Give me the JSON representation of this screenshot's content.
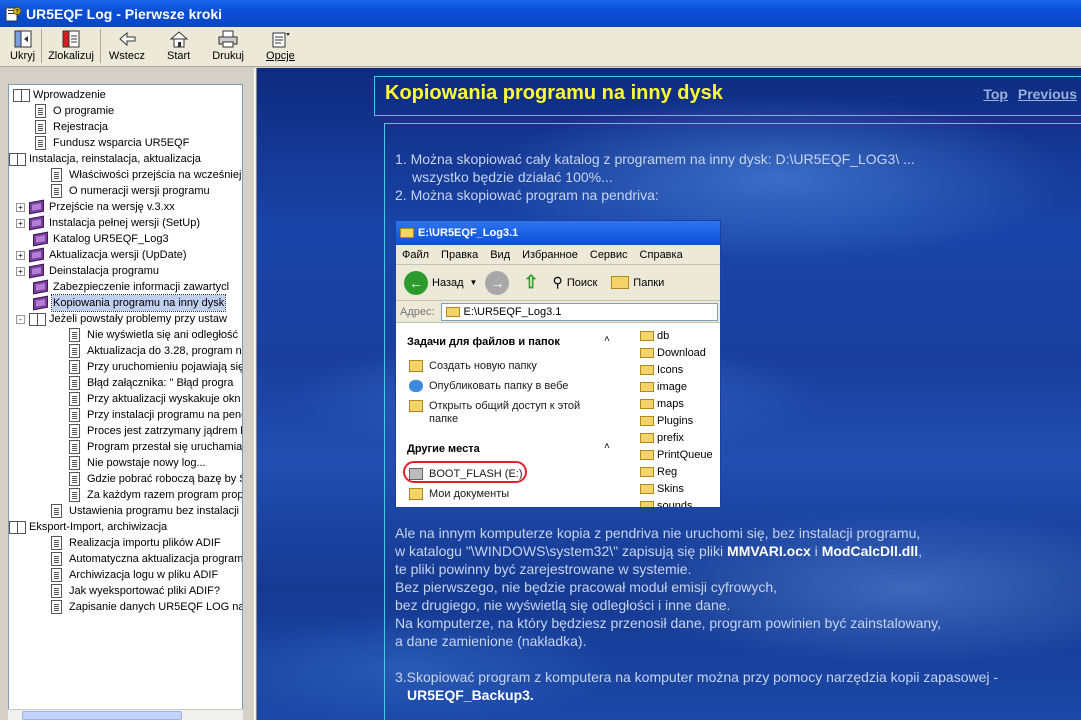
{
  "window": {
    "title": "UR5EQF Log - Pierwsze kroki"
  },
  "toolbar": {
    "buttons": [
      {
        "label": "Ukryj"
      },
      {
        "label": "Zlokalizuj"
      },
      {
        "label": "Wstecz"
      },
      {
        "label": "Start"
      },
      {
        "label": "Drukuj"
      },
      {
        "label": "Opcje"
      }
    ]
  },
  "tree": {
    "items": [
      {
        "label": "Wprowadzenie"
      },
      {
        "label": "O programie"
      },
      {
        "label": "Rejestracja"
      },
      {
        "label": "Fundusz wsparcia UR5EQF"
      },
      {
        "label": "Instalacja, reinstalacja, aktualizacja"
      },
      {
        "label": "Właściwości przejścia na wcześniej"
      },
      {
        "label": "O numeracji wersji programu"
      },
      {
        "label": "Przejście na wersję v.3.xx"
      },
      {
        "label": "Instalacja pełnej wersji (SetUp)"
      },
      {
        "label": "Katalog UR5EQF_Log3"
      },
      {
        "label": "Aktualizacja wersji (UpDate)"
      },
      {
        "label": "Deinstalacja programu"
      },
      {
        "label": "Zabezpieczenie informacji zawartycl"
      },
      {
        "label": "Kopiowania programu na inny dysk"
      },
      {
        "label": "Jeżeli powstały problemy przy ustaw"
      },
      {
        "label": "Nie wyświetla się ani odległość"
      },
      {
        "label": "Aktualizacja do 3.28, program n"
      },
      {
        "label": "Przy uruchomieniu pojawiają się"
      },
      {
        "label": "Błąd załącznika: \" Błąd progra"
      },
      {
        "label": "Przy aktualizacji wyskakuje okn"
      },
      {
        "label": "Przy instalacji programu na penc"
      },
      {
        "label": "Proces jest zatrzymany jądrem b"
      },
      {
        "label": "Program przestał się uruchamia"
      },
      {
        "label": "Nie powstaje nowy log..."
      },
      {
        "label": "Gdzie pobrać roboczą bazę by S"
      },
      {
        "label": "Za każdym razem program propi"
      },
      {
        "label": "Ustawienia programu bez instalacji"
      },
      {
        "label": "Eksport-Import, archiwizacja"
      },
      {
        "label": "Realizacja importu plików ADIF"
      },
      {
        "label": "Automatyczna aktualizacja programi"
      },
      {
        "label": "Archiwizacja logu w pliku ADIF"
      },
      {
        "label": "Jak wyeksportować pliki ADIF?"
      },
      {
        "label": "Zapisanie danych UR5EQF LOG na"
      }
    ]
  },
  "page": {
    "title": "Kopiowania programu na inny dysk",
    "links": {
      "top": "Top",
      "previous": "Previous"
    },
    "list1": "1. Można skopiować cały katalog z programem na inny dysk: D:\\UR5EQF_LOG3\\ ...",
    "list1b": "wszystko będzie działać 100%...",
    "list2": "2. Można skopiować program na pendriva:",
    "para": {
      "l1": "Ale na innym komputerze kopia z pendriva nie uruchomi się, bez instalacji programu,",
      "l2a": "w katalogu \"\\WINDOWS\\system32\\\" zapisują się pliki ",
      "l2b": "MMVARI.ocx",
      "l2c": " i ",
      "l2d": "ModCalcDll.dll",
      "l2e": ",",
      "l3": "te pliki powinny być zarejestrowane w systemie.",
      "l4": "Bez pierwszego, nie będzie pracował moduł emisji cyfrowych,",
      "l5": "bez drugiego, nie wyświetlą się odległości i inne dane.",
      "l6": "Na komputerze, na który będziesz przenosił dane, program powinien być zainstalowany,",
      "l7": "a dane zamienione (nakładka)."
    },
    "list3": "3.Skopiować program z komputera na komputer można przy pomocy narzędzia kopii zapasowej -",
    "list3b": "UR5EQF_Backup3."
  },
  "explorer": {
    "title": "E:\\UR5EQF_Log3.1",
    "menu": [
      "Файл",
      "Правка",
      "Вид",
      "Избранное",
      "Сервис",
      "Справка"
    ],
    "back": "Назад",
    "search": "Поиск",
    "folders_btn": "Папки",
    "address_label": "Адрес:",
    "address": "E:\\UR5EQF_Log3.1",
    "tasks_header": "Задачи для файлов и папок",
    "tasks": [
      "Создать новую папку",
      "Опубликовать папку в вебе",
      "Открыть общий доступ к этой",
      "папке"
    ],
    "places_header": "Другие места",
    "places": [
      "BOOT_FLASH (E:)",
      "Мои документы"
    ],
    "folders": [
      "db",
      "Download",
      "Icons",
      "image",
      "maps",
      "Plugins",
      "prefix",
      "PrintQueue",
      "Reg",
      "Skins",
      "sounds"
    ]
  },
  "colors": {
    "title_yellow": "#ffff33",
    "frame_cyan": "#3fd0e0",
    "highlight_red": "#e0202a"
  }
}
